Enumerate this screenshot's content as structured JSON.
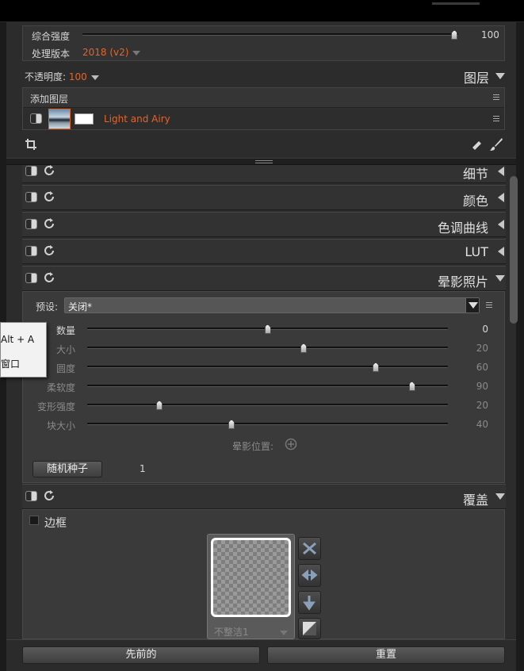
{
  "top": {
    "overall_strength_label": "综合强度",
    "overall_strength_value": "100",
    "overall_strength_fraction": 0.99,
    "process_version_label": "处理版本",
    "process_version_value": "2018 (v2)"
  },
  "opacity": {
    "label": "不透明度:",
    "value": "100"
  },
  "layers": {
    "title": "图层",
    "add_layer_label": "添加图层",
    "layer_name": "Light and Airy"
  },
  "panels": {
    "detail": "细节",
    "color": "颜色",
    "tone_curve": "色调曲线",
    "lut": "LUT",
    "vignette": "晕影照片",
    "overlay": "覆盖"
  },
  "vignette": {
    "preset_label": "预设:",
    "preset_value": "关闭*",
    "sliders": [
      {
        "label": "数量",
        "value": "0",
        "fraction": 0.5
      },
      {
        "label": "大小",
        "value": "20",
        "fraction": 0.6
      },
      {
        "label": "圆度",
        "value": "60",
        "fraction": 0.8
      },
      {
        "label": "柔软度",
        "value": "90",
        "fraction": 0.9
      },
      {
        "label": "变形强度",
        "value": "20",
        "fraction": 0.2
      },
      {
        "label": "块大小",
        "value": "40",
        "fraction": 0.4
      }
    ],
    "position_label": "晕影位置:",
    "random_seed_label": "随机种子",
    "random_seed_value": "1"
  },
  "tooltip": {
    "line1": "Alt + A",
    "line2": "窗口"
  },
  "overlay": {
    "border_label": "边框",
    "texture_name": "不整洁1"
  },
  "footer": {
    "previous_label": "先前的",
    "reset_label": "重置"
  },
  "colors": {
    "accent": "#e2652a",
    "panel": "#323232",
    "background": "#2c2c2c"
  }
}
